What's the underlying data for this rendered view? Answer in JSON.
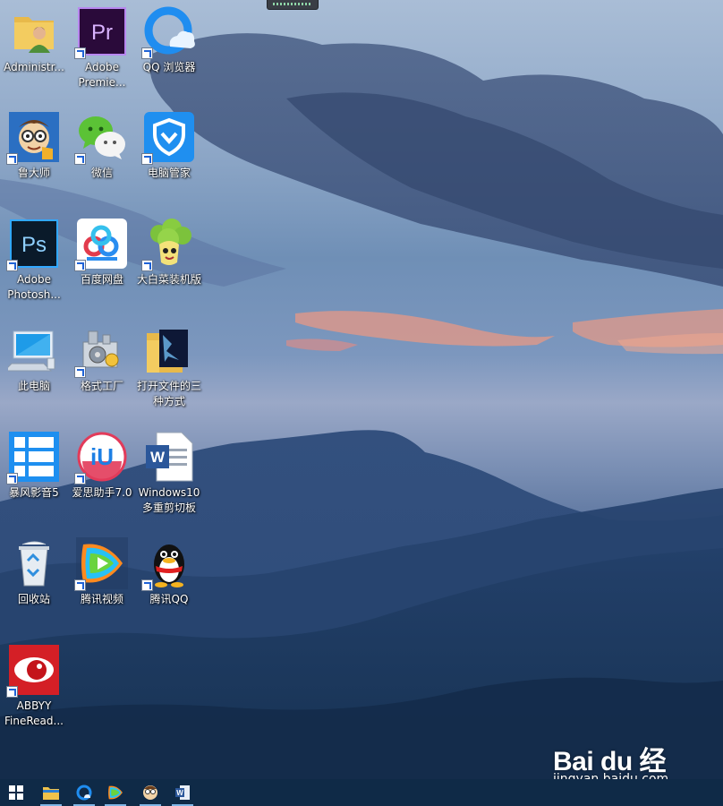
{
  "desktop": {
    "icons": [
      {
        "label": "Administr...",
        "icon": "user-folder-icon",
        "shortcut": false
      },
      {
        "label": "Adobe\nPremie...",
        "icon": "premiere-pro-icon",
        "shortcut": true
      },
      {
        "label": "QQ 浏览器",
        "icon": "qq-browser-icon",
        "shortcut": true
      },
      {
        "label": "鲁大师",
        "icon": "ludashi-icon",
        "shortcut": true
      },
      {
        "label": "微信",
        "icon": "wechat-icon",
        "shortcut": true
      },
      {
        "label": "电脑管家",
        "icon": "pc-manager-shield-icon",
        "shortcut": true
      },
      {
        "label": "Adobe\nPhotosh...",
        "icon": "photoshop-icon",
        "shortcut": true
      },
      {
        "label": "百度网盘",
        "icon": "baidu-netdisk-icon",
        "shortcut": true
      },
      {
        "label": "大白菜装机版",
        "icon": "dabaicai-icon",
        "shortcut": true
      },
      {
        "label": "此电脑",
        "icon": "this-pc-icon",
        "shortcut": false
      },
      {
        "label": "格式工厂",
        "icon": "format-factory-icon",
        "shortcut": true
      },
      {
        "label": "打开文件的三\n种方式",
        "icon": "folder-icon",
        "shortcut": false
      },
      {
        "label": "暴风影音5",
        "icon": "baofeng-icon",
        "shortcut": true
      },
      {
        "label": "爱思助手7.0",
        "icon": "i4-assistant-icon",
        "shortcut": true
      },
      {
        "label": "Windows10\n多重剪切板",
        "icon": "word-document-icon",
        "shortcut": false
      },
      {
        "label": "回收站",
        "icon": "recycle-bin-icon",
        "shortcut": false
      },
      {
        "label": "腾讯视频",
        "icon": "tencent-video-icon",
        "shortcut": true
      },
      {
        "label": "腾讯QQ",
        "icon": "qq-penguin-icon",
        "shortcut": true
      },
      {
        "label": "ABBYY\nFineRead...",
        "icon": "abbyy-finereader-icon",
        "shortcut": true
      }
    ]
  },
  "taskbar": {
    "items": [
      {
        "icon": "windows-start-icon",
        "active": false
      },
      {
        "icon": "file-explorer-icon",
        "active": true
      },
      {
        "icon": "qq-browser-icon",
        "active": true
      },
      {
        "icon": "tencent-video-icon",
        "active": true
      },
      {
        "icon": "ludashi-icon",
        "active": true
      },
      {
        "icon": "word-icon",
        "active": true
      }
    ]
  },
  "watermark": {
    "logo": "Bai du 经验",
    "url": "jingyan.baidu.com"
  },
  "colors": {
    "taskbar": "#0f2a47",
    "taskbar_indicator": "#7fb6e6",
    "label_text": "#ffffff"
  }
}
